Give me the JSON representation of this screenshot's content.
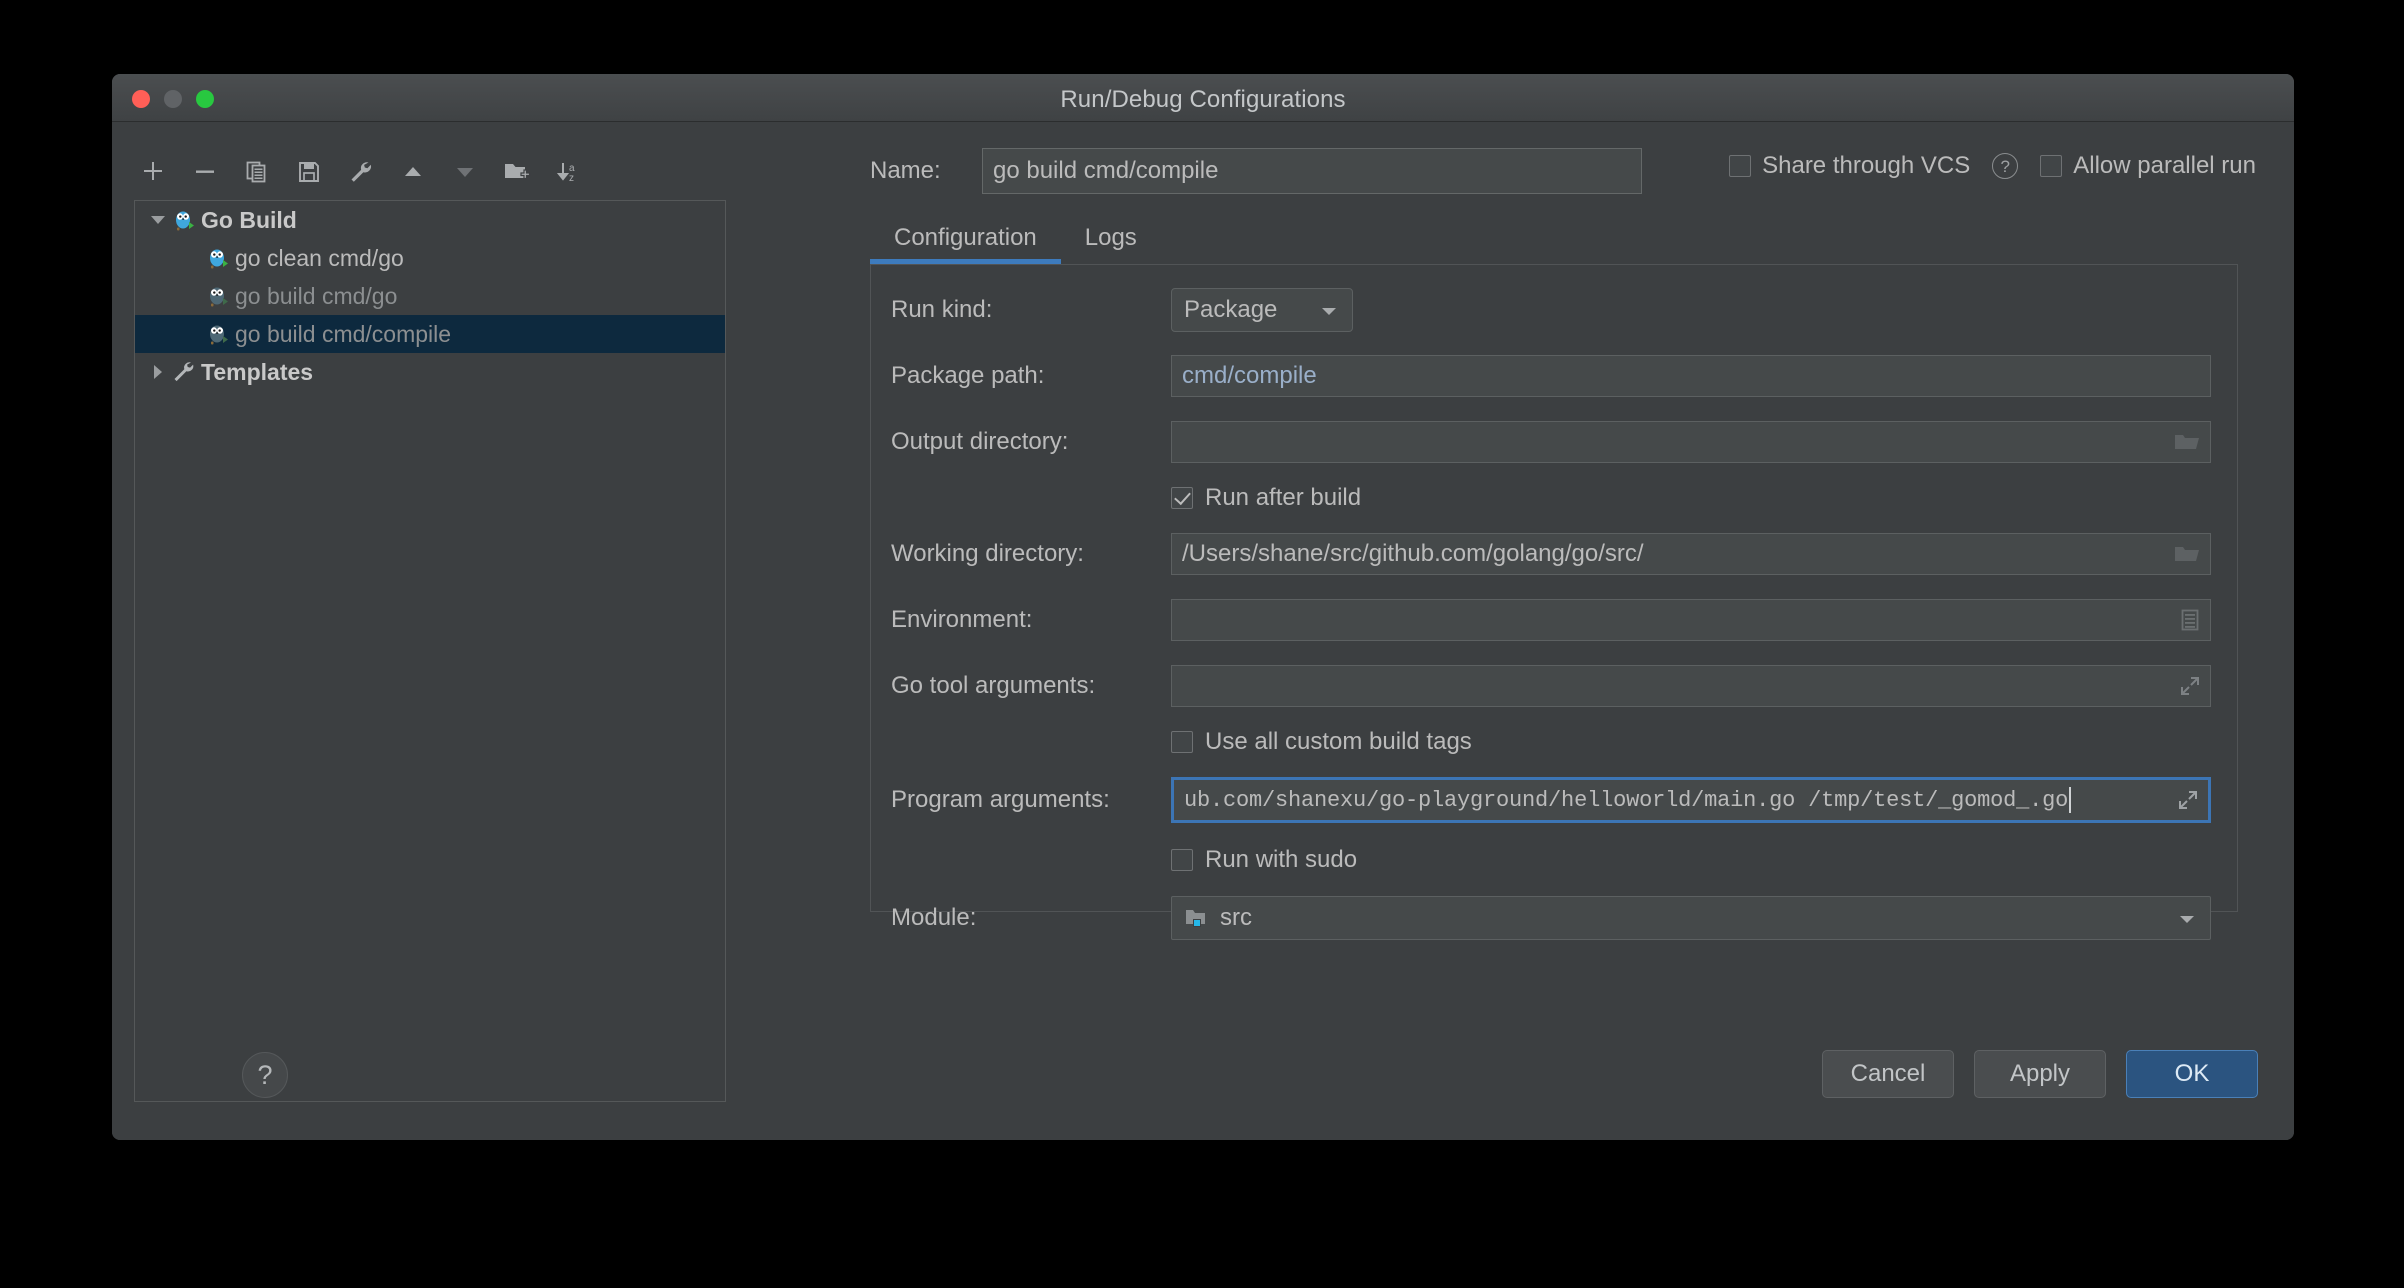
{
  "window": {
    "title": "Run/Debug Configurations",
    "traffic_lights": [
      "close",
      "minimize",
      "maximize"
    ]
  },
  "toolbar": {
    "buttons": [
      {
        "name": "add",
        "icon": "plus-icon"
      },
      {
        "name": "remove",
        "icon": "minus-icon"
      },
      {
        "name": "copy",
        "icon": "copy-icon"
      },
      {
        "name": "save",
        "icon": "save-icon"
      },
      {
        "name": "edit-templates",
        "icon": "wrench-icon"
      },
      {
        "name": "move-up",
        "icon": "arrow-up-icon"
      },
      {
        "name": "move-down",
        "icon": "arrow-down-icon"
      },
      {
        "name": "new-folder",
        "icon": "folder-plus-icon"
      },
      {
        "name": "sort-alphabetically",
        "icon": "sort-az-icon"
      }
    ]
  },
  "tree": {
    "nodes": [
      {
        "label": "Go Build",
        "level": 0,
        "expanded": true,
        "icon": "go-gopher-icon",
        "bold": true,
        "dim": false,
        "selected": false
      },
      {
        "label": "go clean cmd/go",
        "level": 1,
        "expanded": null,
        "icon": "go-gopher-icon",
        "bold": false,
        "dim": false,
        "selected": false
      },
      {
        "label": "go build cmd/go",
        "level": 1,
        "expanded": null,
        "icon": "go-gopher-icon",
        "bold": false,
        "dim": true,
        "selected": false
      },
      {
        "label": "go build cmd/compile",
        "level": 1,
        "expanded": null,
        "icon": "go-gopher-icon",
        "bold": false,
        "dim": true,
        "selected": true
      },
      {
        "label": "Templates",
        "level": 0,
        "expanded": false,
        "icon": "wrench-icon",
        "bold": true,
        "dim": false,
        "selected": false
      }
    ]
  },
  "header": {
    "name_label": "Name:",
    "name_value": "go build cmd/compile",
    "share_vcs_label": "Share through VCS",
    "share_vcs_checked": false,
    "help_icon": "question-mark-icon",
    "allow_parallel_label": "Allow parallel run",
    "allow_parallel_checked": false
  },
  "tabs": [
    {
      "label": "Configuration",
      "active": true
    },
    {
      "label": "Logs",
      "active": false
    }
  ],
  "form": {
    "run_kind_label": "Run kind:",
    "run_kind_value": "Package",
    "package_path_label": "Package path:",
    "package_path_value": "cmd/compile",
    "output_dir_label": "Output directory:",
    "output_dir_value": "",
    "output_dir_icon": "folder-icon",
    "run_after_build_label": "Run after build",
    "run_after_build_checked": true,
    "working_dir_label": "Working directory:",
    "working_dir_value": "/Users/shane/src/github.com/golang/go/src/",
    "working_dir_icon": "folder-icon",
    "environment_label": "Environment:",
    "environment_value": "",
    "environment_icon": "list-icon",
    "go_tool_args_label": "Go tool arguments:",
    "go_tool_args_value": "",
    "go_tool_args_icon": "expand-icon",
    "custom_build_tags_label": "Use all custom build tags",
    "custom_build_tags_checked": false,
    "program_args_label": "Program arguments:",
    "program_args_value": "ub.com/shanexu/go-playground/helloworld/main.go /tmp/test/_gomod_.go",
    "program_args_icon": "expand-icon",
    "program_args_focused": true,
    "run_with_sudo_label": "Run with sudo",
    "run_with_sudo_checked": false,
    "module_label": "Module:",
    "module_value": "src",
    "module_icon": "module-folder-icon"
  },
  "footer": {
    "help_label": "?",
    "cancel_label": "Cancel",
    "apply_label": "Apply",
    "ok_label": "OK"
  },
  "colors": {
    "accent_blue": "#3d7bbd",
    "selection_blue": "#0d293e",
    "primary_button": "#2b5480",
    "window_bg": "#3c3f41",
    "field_bg": "#45494a",
    "text": "#bbbbbb",
    "value_blue": "#9aafc9"
  }
}
